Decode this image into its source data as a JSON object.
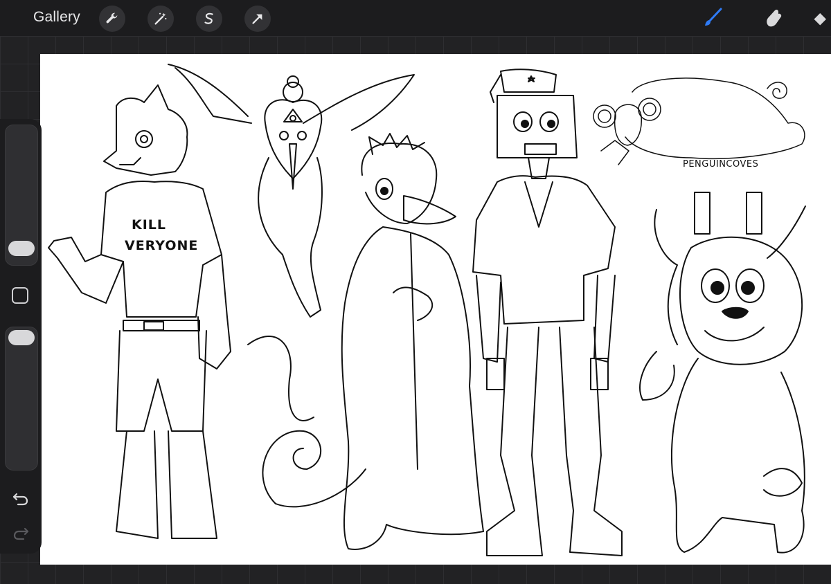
{
  "topbar": {
    "gallery_label": "Gallery",
    "tools": [
      "wrench-icon",
      "magic-wand-icon",
      "selection-s-icon",
      "transform-arrow-icon"
    ],
    "right_tools": [
      "brush-icon",
      "smudge-icon",
      "eraser-icon"
    ],
    "active_tool_color": "#2f7bf6"
  },
  "sidebar": {
    "brush_size_level": 0.82,
    "opacity_level": 0.05,
    "buttons": [
      "modify-square",
      "undo-icon",
      "redo-icon"
    ]
  },
  "canvas": {
    "background": "#ffffff",
    "artwork": {
      "shirt_text_line1": "KILL",
      "shirt_text_line2": "VERYONE",
      "artist_signature": "PENGUINCOVES"
    }
  }
}
